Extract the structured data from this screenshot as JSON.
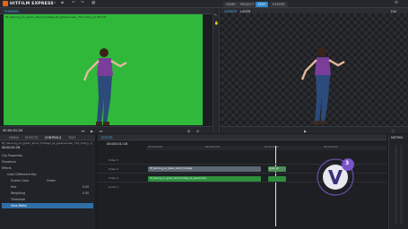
{
  "app": {
    "title": "HITFILM EXPRESS"
  },
  "nav": {
    "tabs": [
      "HOME",
      "PROJECT",
      "EDIT",
      "EXPORT"
    ],
    "active_index": 2
  },
  "trimmer": {
    "tab": "TRIMMER",
    "filename": "Hf_dancing_on_green_stock_footage_pt_greenscreen_7L3_fnet_p_2_lfmodo",
    "timecode": "00:00:01:26"
  },
  "viewer": {
    "tabs": [
      "VIEWER",
      "LAYER"
    ],
    "zoom": "Full"
  },
  "lower_tabs": [
    "MEDIA",
    "EFFECTS",
    "CONTROLS",
    "TEXT"
  ],
  "controls": {
    "clip_label": "Hf_dancing_on_green_stock_footage_pt_greenscreen_7L3_fnet_p_2_lfmodo",
    "timecode": "00:00:01:26",
    "rows": [
      {
        "label": "Clip Properties",
        "value": ""
      },
      {
        "label": "Transform",
        "value": ""
      },
      {
        "label": "Effects",
        "value": ""
      },
      {
        "label": "Color Difference Key",
        "value": ""
      },
      {
        "label": "Screen Color",
        "value": "Green"
      },
      {
        "label": "Hue",
        "value": "0.00"
      },
      {
        "label": "Weighting",
        "value": "0.50"
      },
      {
        "label": "Threshold",
        "value": ""
      },
      {
        "label": "View Matte",
        "value": ""
      }
    ]
  },
  "editor": {
    "tab": "EDITOR",
    "timecode": "00:00:01:16",
    "ruler": [
      "00:00:00:00",
      "00:00:02:00",
      "00:00:04:00",
      "00:00:06:00"
    ],
    "tracks": [
      "Video 3",
      "Video 2",
      "Video 1",
      "Audio 1"
    ],
    "clip_label": "Hf_dancing_on_green_stock_footage",
    "audio_label": "Hf_dancing_on_green_stock_footage_pt_greenscreen",
    "small_clip": "green_pt"
  },
  "meters": {
    "tab": "METERS"
  },
  "watermark": {
    "text": "3"
  },
  "colors": {
    "accent": "#2f88c8",
    "green_screen": "#2fb83a",
    "clip_video": "#5c6773",
    "clip_audio": "#2e8f3c"
  }
}
